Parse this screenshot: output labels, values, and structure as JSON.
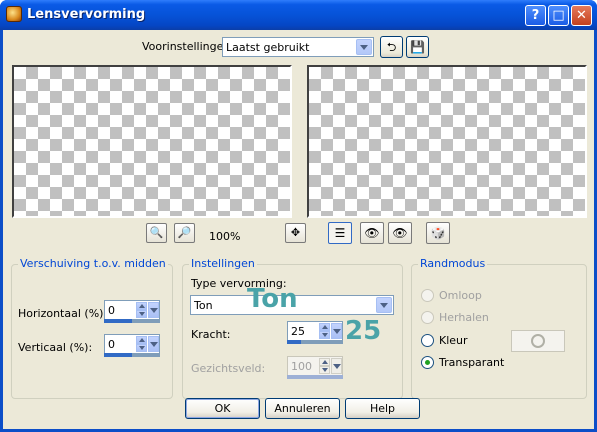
{
  "window": {
    "title": "Lensvervorming",
    "controls": {
      "help": "?",
      "maximize": "□",
      "close": "✕"
    }
  },
  "presets": {
    "label": "Voorinstellingen:",
    "value": "Laatst gebruikt"
  },
  "zoom": {
    "level": "100%"
  },
  "shift_group": {
    "caption": "Verschuiving t.o.v. midden",
    "horizontal": {
      "label": "Horizontaal (%):",
      "value": "0",
      "level": 0.5
    },
    "vertical": {
      "label": "Verticaal (%):",
      "value": "0",
      "level": 0.5
    }
  },
  "settings_group": {
    "caption": "Instellingen",
    "type_label": "Type vervorming:",
    "type_value": "Ton",
    "type_overlay": "Ton",
    "strength": {
      "label": "Kracht:",
      "value": "25",
      "level": 0.25
    },
    "strength_overlay": "25",
    "fov": {
      "label": "Gezichtsveld:",
      "value": "100",
      "level": 1.0,
      "disabled": true
    }
  },
  "edge_group": {
    "caption": "Randmodus",
    "options": [
      {
        "label": "Omloop",
        "checked": false,
        "disabled": true
      },
      {
        "label": "Herhalen",
        "checked": false,
        "disabled": true
      },
      {
        "label": "Kleur",
        "checked": false,
        "disabled": false
      },
      {
        "label": "Transparant",
        "checked": true,
        "disabled": false
      }
    ]
  },
  "buttons": {
    "ok": "OK",
    "cancel": "Annuleren",
    "help": "Help"
  },
  "colors": {
    "accent": "#0046d5",
    "overlay": "#4aa3a8",
    "titlebar": "#0653d8"
  }
}
